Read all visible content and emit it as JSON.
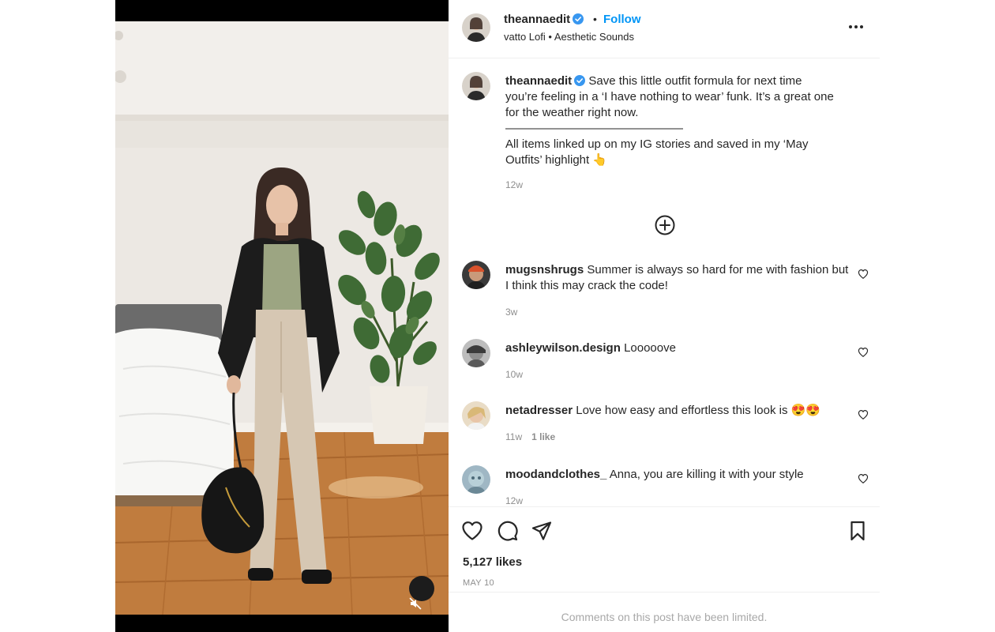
{
  "header": {
    "username": "theannaedit",
    "separator": "•",
    "follow_label": "Follow",
    "audio": "vatto Lofi • Aesthetic Sounds",
    "more_icon": "more-horizontal-icon"
  },
  "caption": {
    "username": "theannaedit",
    "text_line1": "Save this little outfit formula for next time you’re feeling in a ‘I have nothing to wear’ funk. It’s a great one for the weather right now.",
    "divider": "———————————————",
    "text_line2": "All items linked up on my IG stories and saved in my ‘May Outfits’ highlight 👆",
    "time": "12w"
  },
  "load_more_icon": "plus-circle-icon",
  "comments": [
    {
      "username": "mugsnshrugs",
      "text": "Summer is always so hard for me with fashion but I think this may crack the code!",
      "time": "3w",
      "likes": ""
    },
    {
      "username": "ashleywilson.design",
      "text": "Looooove",
      "time": "10w",
      "likes": ""
    },
    {
      "username": "netadresser",
      "text": "Love how easy and effortless this look is 😍😍",
      "time": "11w",
      "likes": "1 like"
    },
    {
      "username": "moodandclothes_",
      "text": "Anna, you are killing it with your style",
      "time": "12w",
      "likes": ""
    }
  ],
  "actions": {
    "like_icon": "heart-icon",
    "comment_icon": "comment-icon",
    "share_icon": "share-icon",
    "save_icon": "bookmark-icon"
  },
  "likes_count": "5,127 likes",
  "post_date": "MAY 10",
  "comments_limited": "Comments on this post have been limited.",
  "colors": {
    "accent": "#0095f6",
    "text": "#262626",
    "muted": "#8e8e8e",
    "border": "#efefef"
  }
}
